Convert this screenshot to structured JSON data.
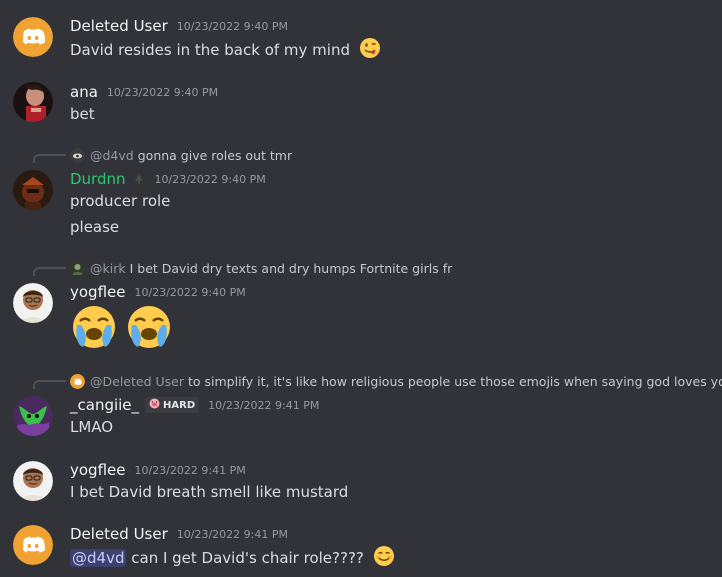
{
  "messages": [
    {
      "username": "Deleted User",
      "timestamp": "10/23/2022 9:40 PM",
      "text": "David resides in the back of my mind",
      "emoji": "winking-tongue-face"
    },
    {
      "username": "ana",
      "timestamp": "10/23/2022 9:40 PM",
      "text": "bet"
    },
    {
      "reply": {
        "user": "@d4vd",
        "text": "gonna give roles out tmr"
      },
      "username": "Durdnn",
      "timestamp": "10/23/2022 9:40 PM",
      "lines": [
        "producer role",
        "please"
      ]
    },
    {
      "reply": {
        "user": "@kirk",
        "text": "I bet David dry texts and dry humps Fortnite girls fr"
      },
      "username": "yogflee",
      "timestamp": "10/23/2022 9:40 PM",
      "emojis": [
        "loudly-crying-face",
        "loudly-crying-face"
      ]
    },
    {
      "reply": {
        "user": "@Deleted User",
        "text": "to simplify it, it's like how religious people use those emojis when saying god loves you"
      },
      "username": "_cangiie_",
      "role_badge": "HARD",
      "timestamp": "10/23/2022 9:41 PM",
      "text": "LMAO"
    },
    {
      "username": "yogflee",
      "timestamp": "10/23/2022 9:41 PM",
      "text": "I bet David breath smell like mustard"
    },
    {
      "username": "Deleted User",
      "timestamp": "10/23/2022 9:41 PM",
      "mention": "@d4vd",
      "text": "can I get David's chair role????",
      "emoji": "smiling-face"
    }
  ],
  "colors": {
    "background": "#313338",
    "discord_blurple_orange_avatar": "#f0a232",
    "green_username": "#2dc770"
  }
}
